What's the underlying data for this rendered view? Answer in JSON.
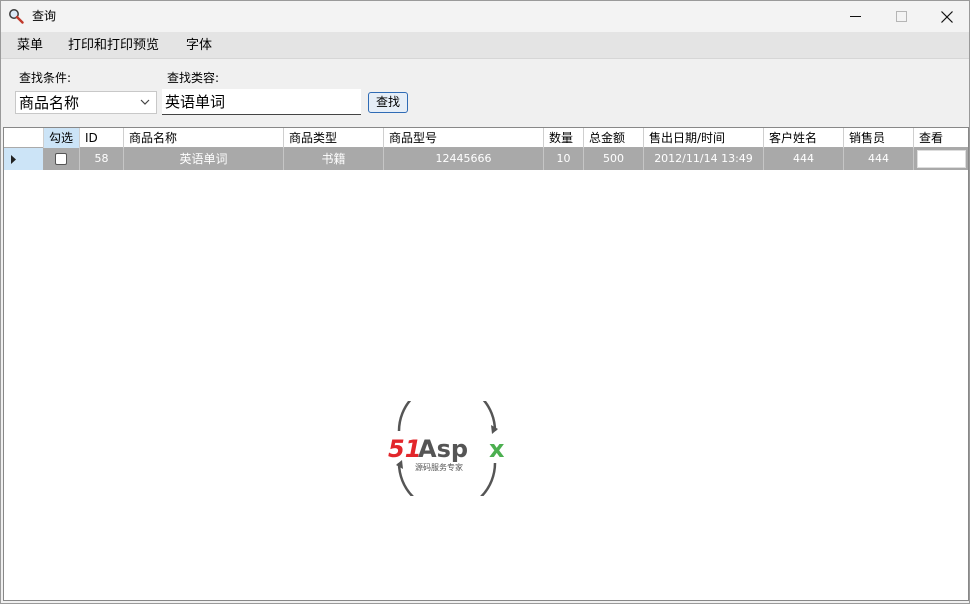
{
  "window": {
    "title": "查询",
    "icon": "magnifier-icon"
  },
  "menu": {
    "items": [
      "菜单",
      "打印和打印预览",
      "字体"
    ]
  },
  "search": {
    "condition_label": "查找条件:",
    "content_label": "查找类容:",
    "condition_value": "商品名称",
    "content_value": "英语单词",
    "button_label": "查找"
  },
  "grid": {
    "columns": [
      "勾选",
      "ID",
      "商品名称",
      "商品类型",
      "商品型号",
      "数量",
      "总金额",
      "售出日期/时间",
      "客户姓名",
      "销售员",
      "查看"
    ],
    "rows": [
      {
        "checked": false,
        "id": "58",
        "name": "英语单词",
        "type": "书籍",
        "model": "12445666",
        "qty": "10",
        "total": "500",
        "datetime": "2012/11/14 13:49",
        "customer": "444",
        "seller": "444",
        "view": ""
      }
    ]
  },
  "logo": {
    "brand_text": "51Aspx",
    "tagline": "源码服务专家"
  },
  "colors": {
    "selected_row": "#a9a9a9",
    "header_highlight": "#cce4f7",
    "button_border": "#2f6bb5",
    "logo_red": "#e2262b",
    "logo_green": "#4caf50",
    "logo_gray": "#555555"
  }
}
